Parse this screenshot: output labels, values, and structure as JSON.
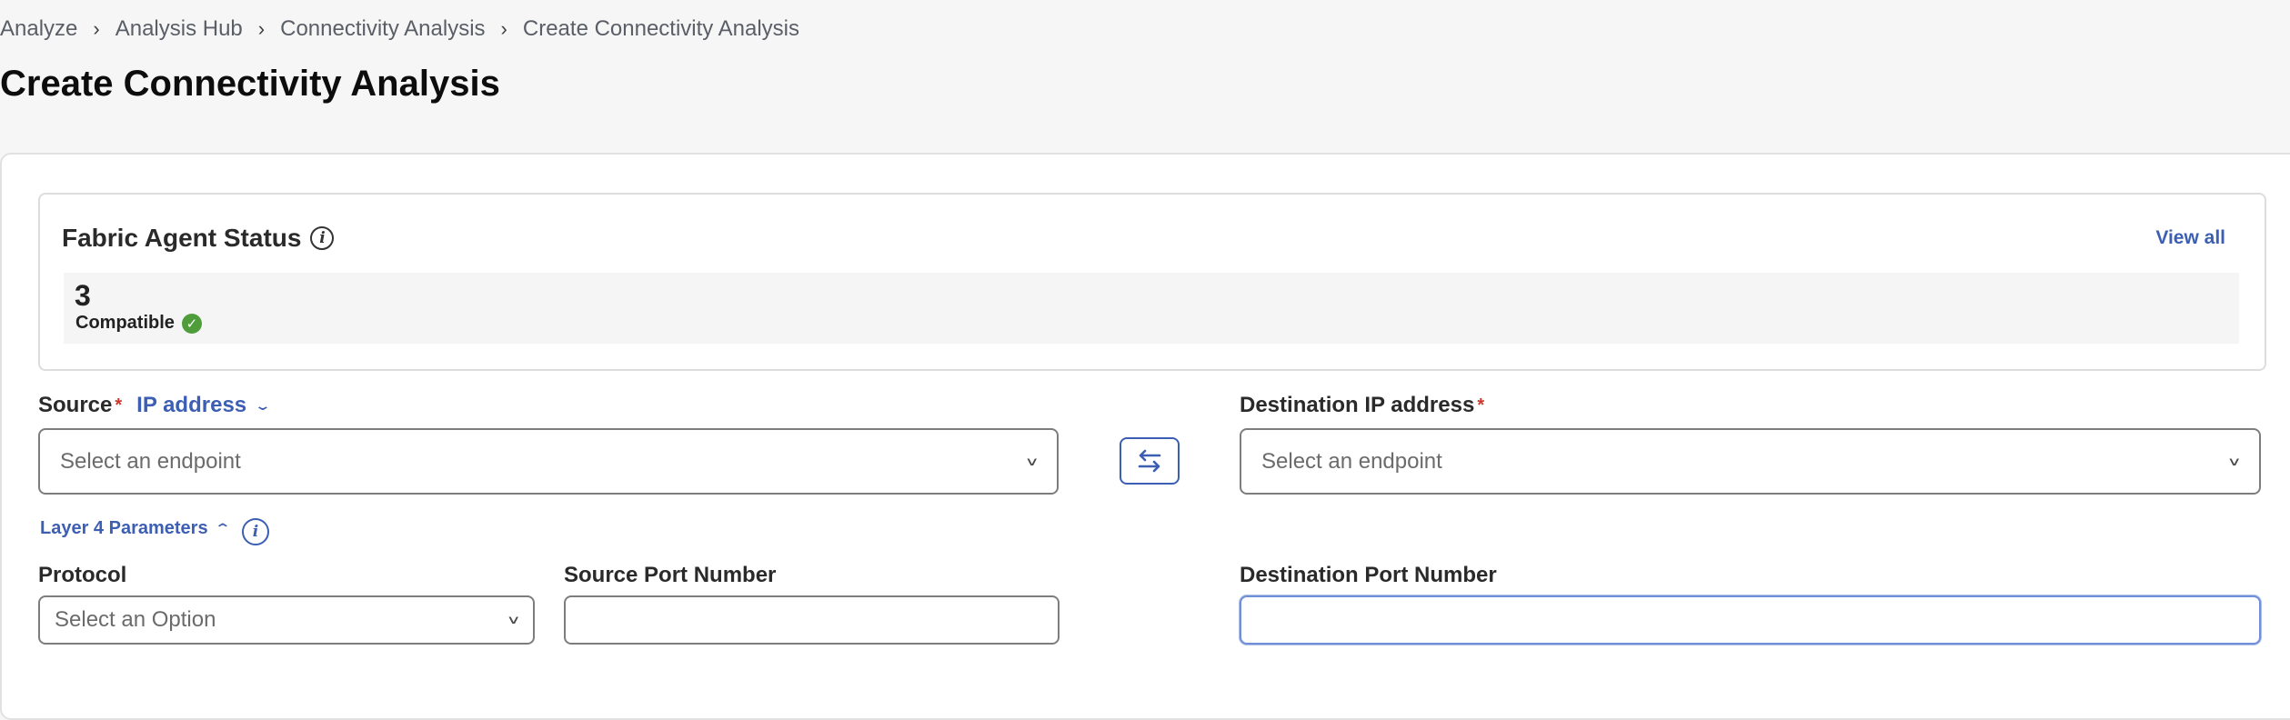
{
  "breadcrumb": [
    "Analyze",
    "Analysis Hub",
    "Connectivity Analysis",
    "Create Connectivity Analysis"
  ],
  "page_title": "Create Connectivity Analysis",
  "fabric_status": {
    "title": "Fabric Agent Status",
    "view_all": "View all",
    "count": "3",
    "label": "Compatible"
  },
  "source": {
    "label": "Source",
    "required_mark": "*",
    "type": "IP address",
    "placeholder": "Select an endpoint"
  },
  "destination": {
    "label": "Destination IP address",
    "required_mark": "*",
    "placeholder": "Select an endpoint"
  },
  "layer4": {
    "label": "Layer 4 Parameters",
    "protocol_label": "Protocol",
    "protocol_placeholder": "Select an Option",
    "source_port_label": "Source Port Number",
    "source_port_value": "",
    "destination_port_label": "Destination Port Number",
    "destination_port_value": ""
  },
  "icons": {
    "breadcrumb_separator": "chevron-right-icon",
    "status_info": "info-icon",
    "compatible": "check-circle-icon",
    "dropdown": "chevron-down-icon",
    "swap": "swap-arrows-icon",
    "collapse": "chevron-up-icon"
  },
  "colors": {
    "accent": "#3c5fb3",
    "required": "#d0362a",
    "success": "#4f9d3a"
  }
}
